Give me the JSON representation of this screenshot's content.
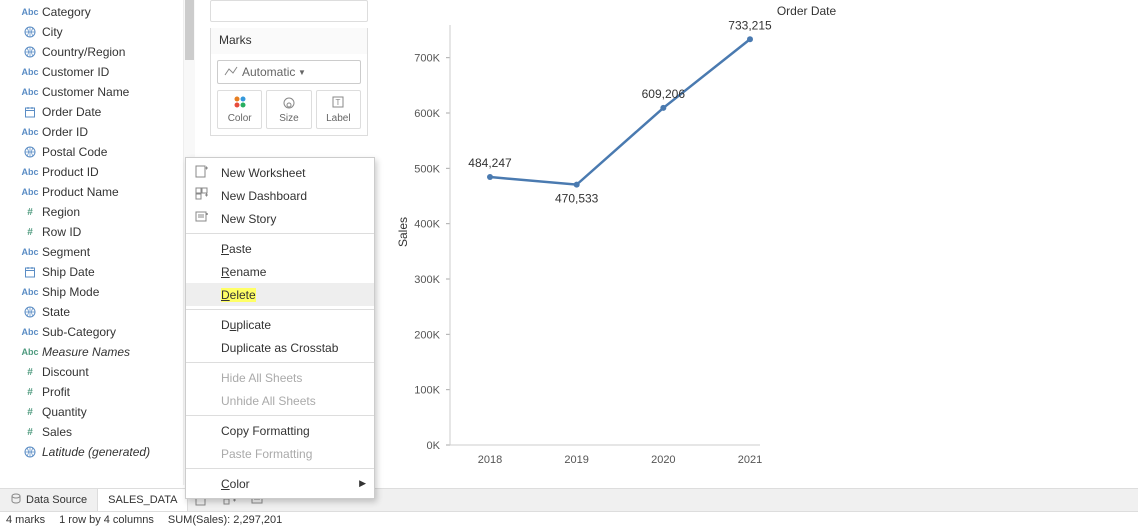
{
  "fields": [
    {
      "icon": "abc",
      "label": "Category"
    },
    {
      "icon": "globe",
      "label": "City"
    },
    {
      "icon": "globe",
      "label": "Country/Region"
    },
    {
      "icon": "abc",
      "label": "Customer ID"
    },
    {
      "icon": "abc",
      "label": "Customer Name"
    },
    {
      "icon": "calendar",
      "label": "Order Date"
    },
    {
      "icon": "abc",
      "label": "Order ID"
    },
    {
      "icon": "globe",
      "label": "Postal Code"
    },
    {
      "icon": "abc",
      "label": "Product ID"
    },
    {
      "icon": "abc",
      "label": "Product Name"
    },
    {
      "icon": "hash",
      "label": "Region"
    },
    {
      "icon": "hash",
      "label": "Row ID"
    },
    {
      "icon": "abc",
      "label": "Segment"
    },
    {
      "icon": "calendar",
      "label": "Ship Date"
    },
    {
      "icon": "abc",
      "label": "Ship Mode"
    },
    {
      "icon": "globe",
      "label": "State"
    },
    {
      "icon": "abc",
      "label": "Sub-Category"
    },
    {
      "icon": "abc",
      "label": "Measure Names",
      "italic": true
    },
    {
      "icon": "hash",
      "label": "Discount"
    },
    {
      "icon": "hash",
      "label": "Profit"
    },
    {
      "icon": "hash",
      "label": "Quantity"
    },
    {
      "icon": "hash",
      "label": "Sales"
    },
    {
      "icon": "globe",
      "label": "Latitude (generated)",
      "italic": true
    }
  ],
  "marks": {
    "title": "Marks",
    "dropdown": "Automatic",
    "buttons": {
      "color": "Color",
      "size": "Size",
      "label": "Label"
    }
  },
  "context_menu": {
    "new_worksheet": "New Worksheet",
    "new_dashboard": "New Dashboard",
    "new_story": "New Story",
    "paste": "Paste",
    "rename": "Rename",
    "delete": "Delete",
    "duplicate": "Duplicate",
    "duplicate_crosstab": "Duplicate as Crosstab",
    "hide_all": "Hide All Sheets",
    "unhide_all": "Unhide All Sheets",
    "copy_formatting": "Copy Formatting",
    "paste_formatting": "Paste Formatting",
    "color": "Color"
  },
  "tabs": {
    "data_source": "Data Source",
    "sheet": "SALES_DATA"
  },
  "status": {
    "marks": "4 marks",
    "rows": "1 row by 4 columns",
    "sum": "SUM(Sales): 2,297,201"
  },
  "chart_data": {
    "type": "line",
    "title": "Order Date",
    "xlabel": "",
    "ylabel": "Sales",
    "categories": [
      "2018",
      "2019",
      "2020",
      "2021"
    ],
    "values": [
      484247,
      470533,
      609206,
      733215
    ],
    "ylim": [
      0,
      750000
    ],
    "yticks": [
      "0K",
      "100K",
      "200K",
      "300K",
      "400K",
      "500K",
      "600K",
      "700K"
    ],
    "data_labels": [
      "484,247",
      "470,533",
      "609,206",
      "733,215"
    ]
  }
}
